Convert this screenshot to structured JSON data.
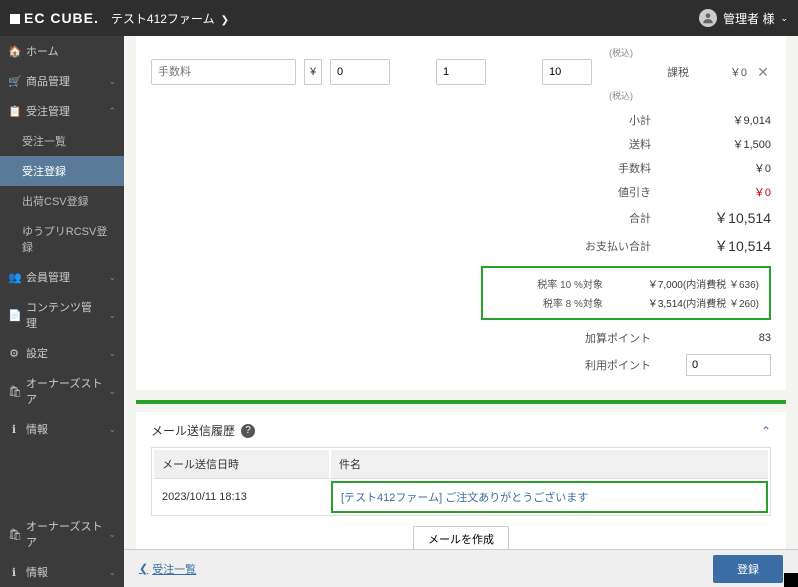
{
  "header": {
    "logo": "EC CUBE",
    "page_title": "テスト412ファーム",
    "user_label": "管理者 様"
  },
  "sidebar": {
    "top": [
      {
        "icon": "🏠",
        "label": "ホーム",
        "expand": ""
      },
      {
        "icon": "🛒",
        "label": "商品管理",
        "expand": "⌄"
      },
      {
        "icon": "📋",
        "label": "受注管理",
        "expand": "⌃"
      },
      {
        "icon": "",
        "label": "受注一覧",
        "sub": true
      },
      {
        "icon": "",
        "label": "受注登録",
        "sub": true,
        "active": true
      },
      {
        "icon": "",
        "label": "出荷CSV登録",
        "sub": true
      },
      {
        "icon": "",
        "label": "ゆうプリRCSV登録",
        "sub": true
      },
      {
        "icon": "👥",
        "label": "会員管理",
        "expand": "⌄"
      },
      {
        "icon": "📄",
        "label": "コンテンツ管理",
        "expand": "⌄"
      },
      {
        "icon": "⚙",
        "label": "設定",
        "expand": "⌄"
      },
      {
        "icon": "🛍",
        "label": "オーナーズストア",
        "expand": "⌄"
      },
      {
        "icon": "ℹ",
        "label": "情報",
        "expand": "⌄"
      }
    ],
    "bottom": [
      {
        "icon": "🛍",
        "label": "オーナーズストア",
        "expand": "⌄"
      },
      {
        "icon": "ℹ",
        "label": "情報",
        "expand": "⌄"
      }
    ]
  },
  "fee_row": {
    "name_placeholder": "手数料",
    "currency": "¥",
    "price": "0",
    "qty": "1",
    "tax": "10",
    "tax_label": "課税",
    "tax_value": "￥0",
    "tax_note": "(税込)"
  },
  "totals": {
    "subtotal_lbl": "小計",
    "subtotal_val": "￥9,014",
    "ship_lbl": "送料",
    "ship_val": "￥1,500",
    "fee_lbl": "手数料",
    "fee_val": "￥0",
    "disc_lbl": "値引き",
    "disc_val": "￥0",
    "total_lbl": "合計",
    "total_val": "￥10,514",
    "pay_lbl": "お支払い合計",
    "pay_val": "￥10,514",
    "taxbox": {
      "r1_lbl": "税率 10 %対象",
      "r1_val": "￥7,000",
      "r1_det": "(内消費税 ￥636)",
      "r2_lbl": "税率 8 %対象",
      "r2_val": "￥3,514",
      "r2_det": "(内消費税 ￥260)"
    },
    "addpt_lbl": "加算ポイント",
    "addpt_val": "83",
    "usept_lbl": "利用ポイント",
    "usept_val": "0"
  },
  "mail": {
    "title": "メール送信履歴",
    "col_date": "メール送信日時",
    "col_subject": "件名",
    "row_date": "2023/10/11 18:13",
    "row_subject": "[テスト412ファーム] ご注文ありがとうございます",
    "compose_btn": "メールを作成"
  },
  "footer": {
    "back": "受注一覧",
    "register": "登録"
  }
}
